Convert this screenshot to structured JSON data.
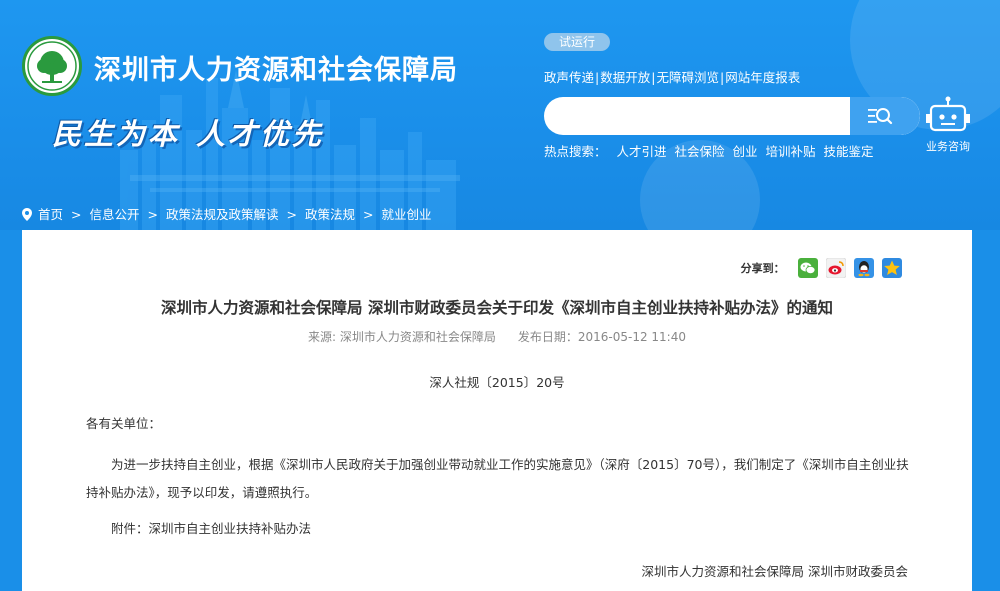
{
  "header": {
    "site_title": "深圳市人力资源和社会保障局",
    "slogan_left": "民生为本",
    "slogan_right": "人才优先",
    "trial_badge": "试运行",
    "top_links": [
      "政声传递",
      "数据开放",
      "无障碍浏览",
      "网站年度报表"
    ],
    "top_links_sep": "|",
    "search": {
      "placeholder": "",
      "button_icon": "search-icon"
    },
    "hot_search": {
      "label": "热点搜索：",
      "items": [
        "人才引进",
        "社会保险",
        "创业",
        "培训补贴",
        "技能鉴定"
      ]
    },
    "consult_label": "业务咨询"
  },
  "breadcrumb": {
    "items": [
      "首页",
      "信息公开",
      "政策法规及政策解读",
      "政策法规",
      "就业创业"
    ],
    "separator": ">"
  },
  "article": {
    "share_label": "分享到：",
    "share_icons": [
      "wechat-icon",
      "weibo-icon",
      "qq-icon",
      "qzone-icon"
    ],
    "title": "深圳市人力资源和社会保障局 深圳市财政委员会关于印发《深圳市自主创业扶持补贴办法》的通知",
    "source": "来源: 深圳市人力资源和社会保障局",
    "publish_date": "发布日期：2016-05-12 11:40",
    "doc_number": "深人社规〔2015〕20号",
    "salutation": "各有关单位：",
    "body": "为进一步扶持自主创业，根据《深圳市人民政府关于加强创业带动就业工作的实施意见》（深府〔2015〕70号），我们制定了《深圳市自主创业扶持补贴办法》，现予以印发，请遵照执行。",
    "attachment": "附件：深圳市自主创业扶持补贴办法",
    "signature": "深圳市人力资源和社会保障局 深圳市财政委员会"
  },
  "colors": {
    "header_blue": "#1a8fe8",
    "search_button": "#3fa2f0",
    "logo_green": "#2a9a3e"
  }
}
